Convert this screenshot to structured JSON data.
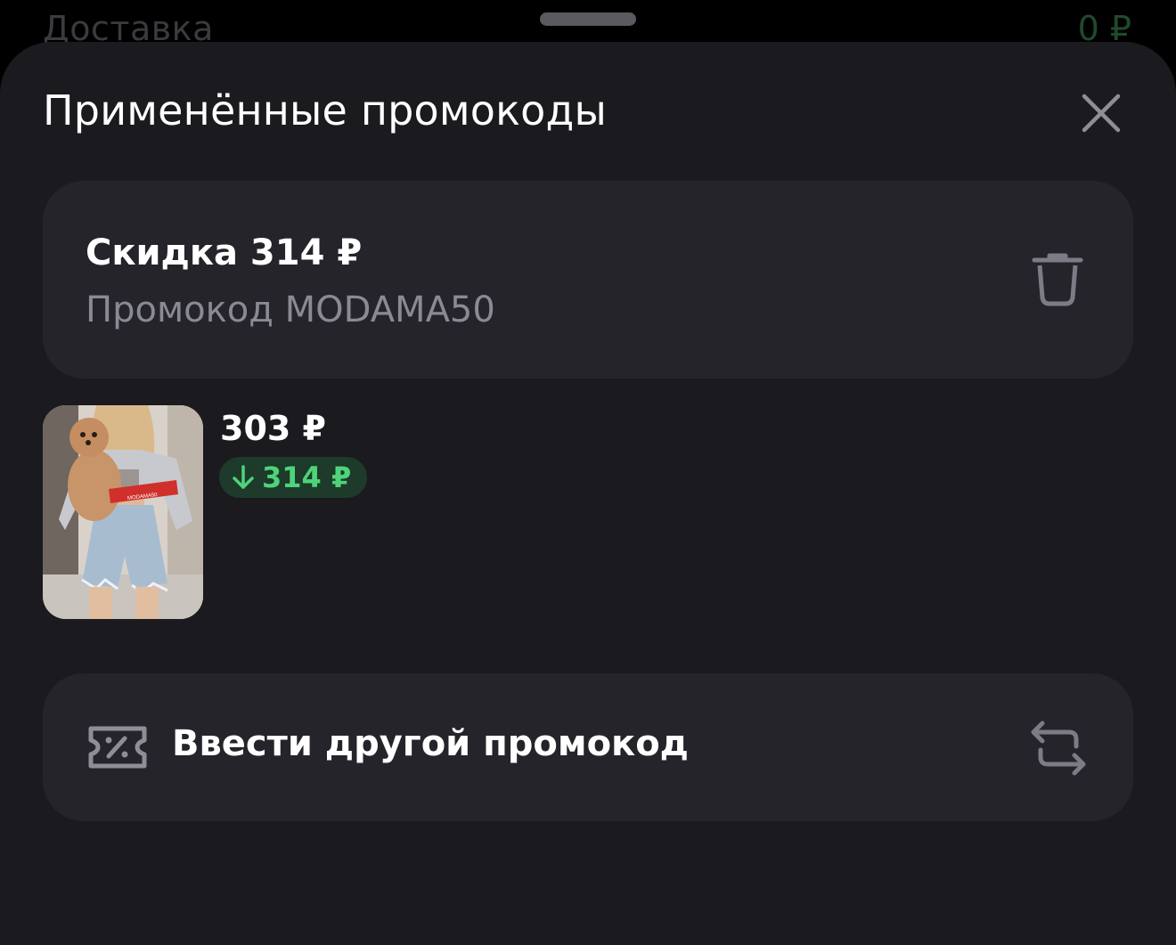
{
  "background": {
    "delivery_label": "Доставка",
    "delivery_value": "0 ₽"
  },
  "sheet": {
    "title": "Применённые промокоды",
    "close_icon": "close-icon"
  },
  "promo": {
    "discount_title": "Скидка 314 ₽",
    "promo_code_label": "Промокод MODAMA50",
    "delete_icon": "trash-icon"
  },
  "product": {
    "price": "303 ₽",
    "discount_amount": "314 ₽",
    "discount_icon": "arrow-down-icon",
    "image_banner_text": "MODAMA50"
  },
  "other_promo": {
    "label": "Ввести другой промокод",
    "ticket_icon": "discount-ticket-icon",
    "swap_icon": "swap-icon"
  },
  "colors": {
    "sheet_bg": "#1a1a1f",
    "card_bg": "#24242a",
    "accent_green": "#4ed37a",
    "badge_bg": "#1d3a2a",
    "muted_text": "#8a8a94"
  }
}
